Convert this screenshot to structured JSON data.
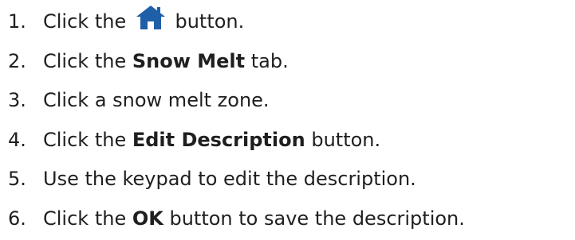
{
  "steps": [
    {
      "number": "1.",
      "before": "Click the",
      "icon": "home-icon",
      "after": "button."
    },
    {
      "number": "2.",
      "before": "Click the",
      "bold": "Snow Melt",
      "after": "tab."
    },
    {
      "number": "3.",
      "text": "Click a snow melt zone."
    },
    {
      "number": "4.",
      "before": "Click the",
      "bold": "Edit Description",
      "after": "button."
    },
    {
      "number": "5.",
      "text": "Use the keypad to edit the description."
    },
    {
      "number": "6.",
      "before": "Click the",
      "bold": "OK",
      "after": "button to save the description."
    }
  ],
  "colors": {
    "text": "#1f1f1f",
    "icon": "#1f5fa8"
  }
}
